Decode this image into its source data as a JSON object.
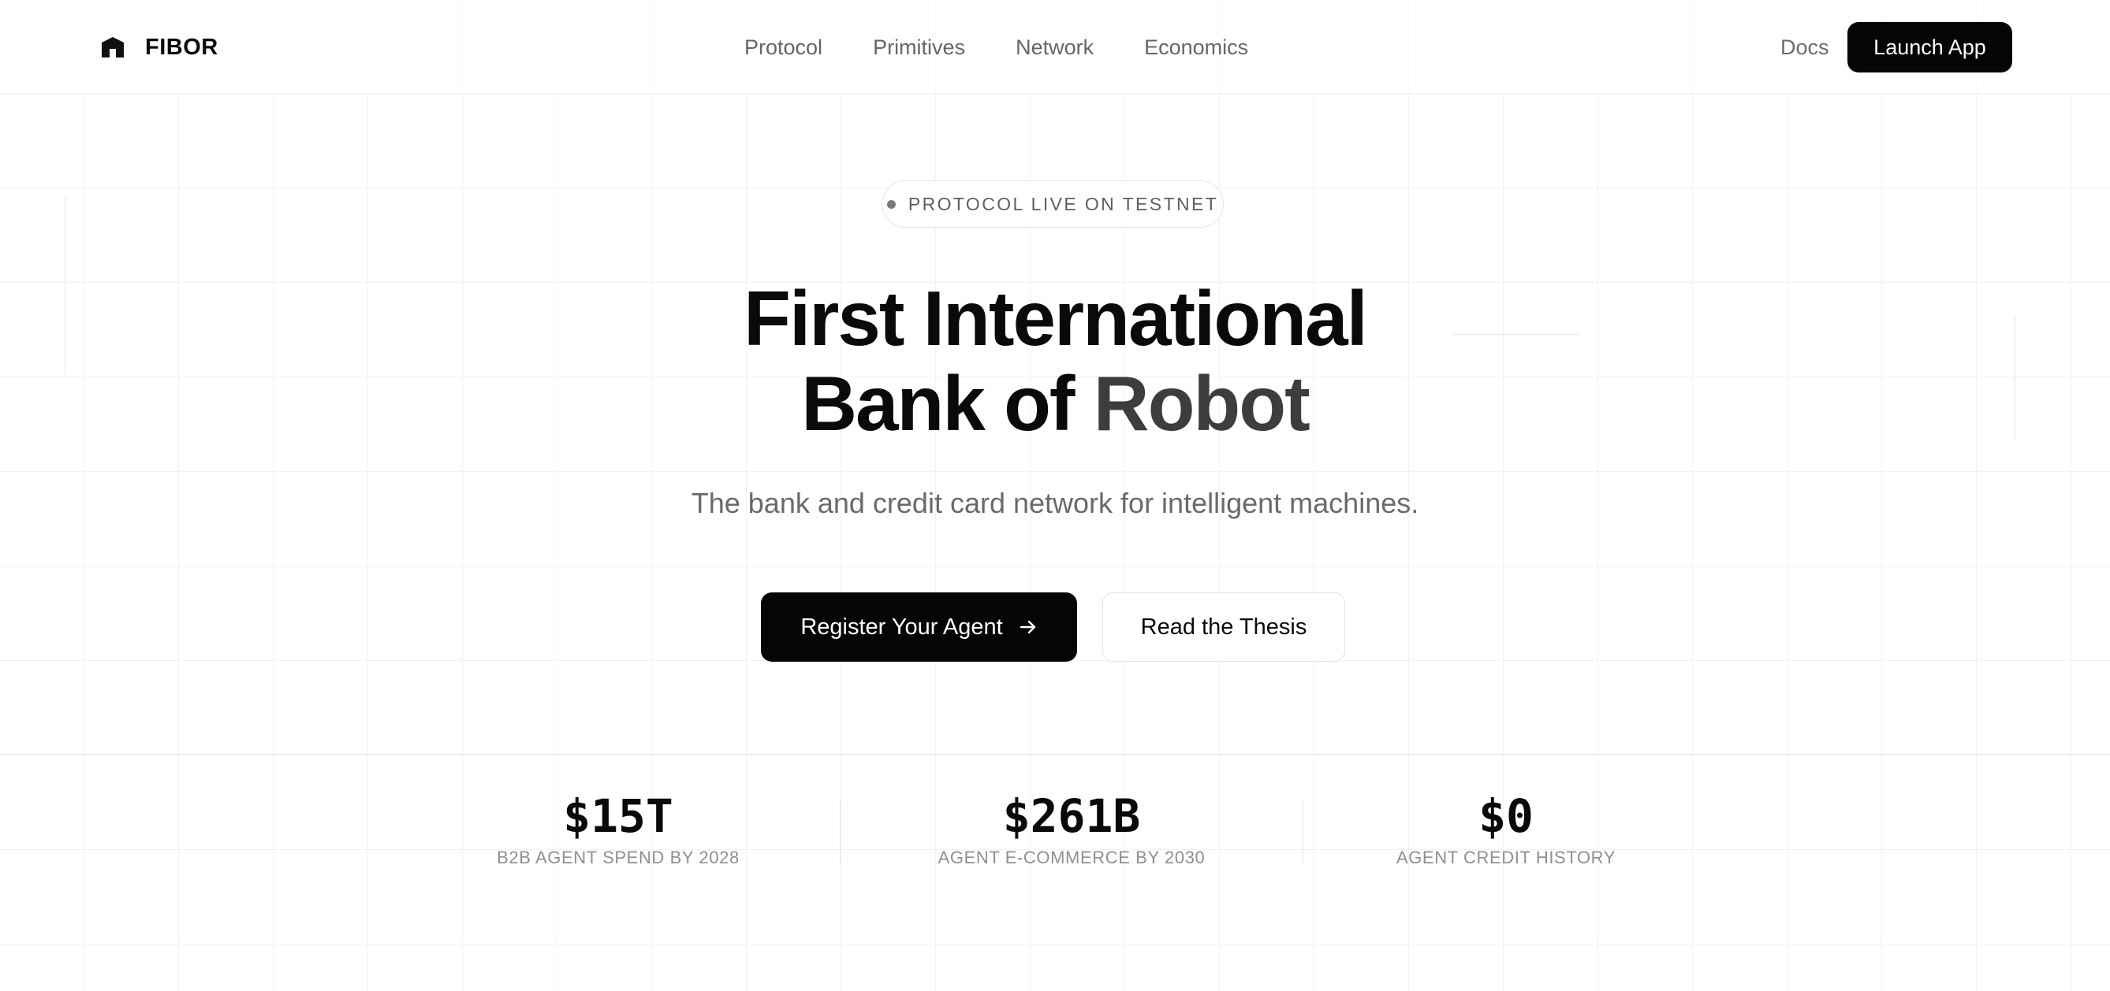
{
  "brand": {
    "name": "FIBOR",
    "logo_icon": "bank-building-icon"
  },
  "nav": {
    "links": [
      "Protocol",
      "Primitives",
      "Network",
      "Economics"
    ],
    "docs_label": "Docs",
    "launch_label": "Launch App"
  },
  "hero": {
    "badge": "PROTOCOL LIVE ON TESTNET",
    "title_line1": "First International",
    "title_line2_a": "Bank of ",
    "title_line2_b": "Robot",
    "subtitle": "The bank and credit card network for intelligent machines.",
    "primary_cta": "Register Your Agent",
    "primary_cta_icon": "arrow-right-icon",
    "secondary_cta": "Read the Thesis"
  },
  "stats": [
    {
      "value": "$15T",
      "label": "B2B AGENT SPEND BY 2028"
    },
    {
      "value": "$261B",
      "label": "AGENT E-COMMERCE BY 2030"
    },
    {
      "value": "$0",
      "label": "AGENT CREDIT HISTORY"
    }
  ],
  "colors": {
    "background": "#ffffff",
    "primary": "#050505",
    "muted_text": "#6a6a6a",
    "grid": "#f2f2f2"
  }
}
